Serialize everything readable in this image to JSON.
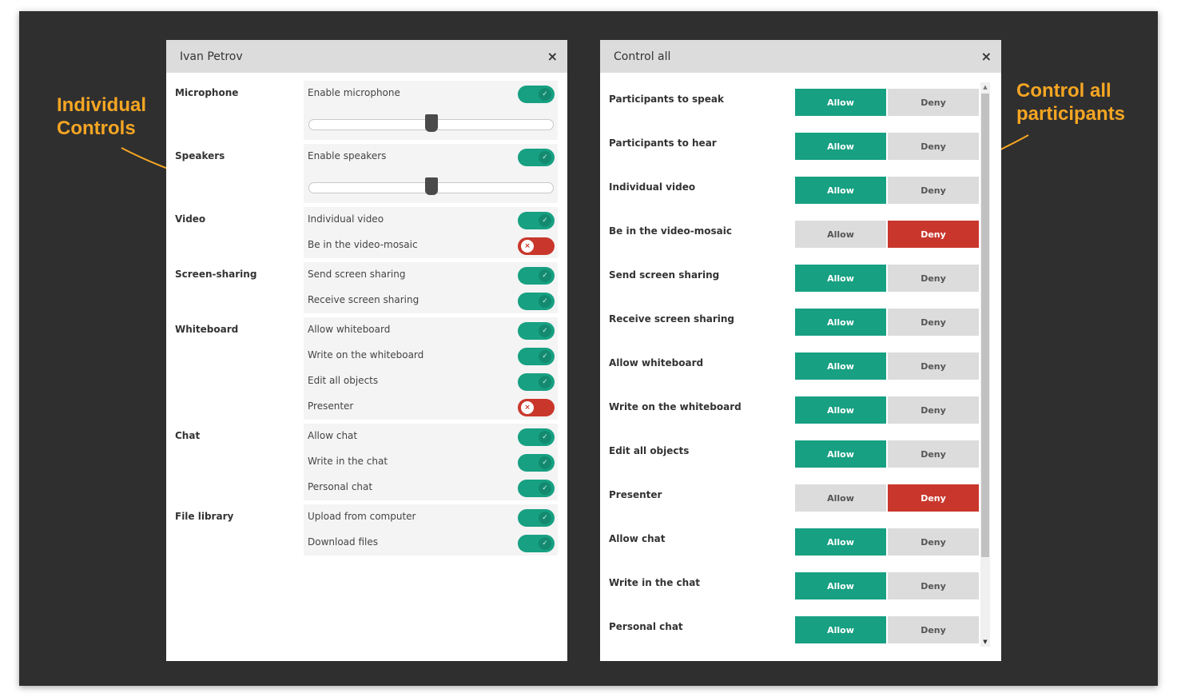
{
  "annotations": {
    "left": [
      "Individual",
      "Controls"
    ],
    "right": [
      "Control all",
      "participants"
    ]
  },
  "colors": {
    "accent": "#17a082",
    "deny": "#c9372c",
    "annotation": "#f6a623",
    "background": "#2f2f2f"
  },
  "individual": {
    "title": "Ivan Petrov",
    "close_icon": "×",
    "icons": {
      "close": "close-icon",
      "check": "check-icon",
      "cross": "x-icon"
    },
    "on_glyph": "✓",
    "off_glyph": "×",
    "sections": [
      {
        "name": "Microphone",
        "items": [
          {
            "label": "Enable microphone",
            "on": true
          }
        ],
        "volume": 0.5
      },
      {
        "name": "Speakers",
        "items": [
          {
            "label": "Enable speakers",
            "on": true
          }
        ],
        "volume": 0.5
      },
      {
        "name": "Video",
        "items": [
          {
            "label": "Individual video",
            "on": true
          },
          {
            "label": "Be in the video-mosaic",
            "on": false
          }
        ]
      },
      {
        "name": "Screen-sharing",
        "items": [
          {
            "label": "Send screen sharing",
            "on": true
          },
          {
            "label": "Receive screen sharing",
            "on": true
          }
        ]
      },
      {
        "name": "Whiteboard",
        "items": [
          {
            "label": "Allow whiteboard",
            "on": true
          },
          {
            "label": "Write on the whiteboard",
            "on": true
          },
          {
            "label": "Edit all objects",
            "on": true
          },
          {
            "label": "Presenter",
            "on": false
          }
        ]
      },
      {
        "name": "Chat",
        "items": [
          {
            "label": "Allow chat",
            "on": true
          },
          {
            "label": "Write in the chat",
            "on": true
          },
          {
            "label": "Personal chat",
            "on": true
          }
        ]
      },
      {
        "name": "File library",
        "items": [
          {
            "label": "Upload from computer",
            "on": true
          },
          {
            "label": "Download files",
            "on": true
          }
        ]
      }
    ]
  },
  "control_all": {
    "title": "Control all",
    "close_icon": "×",
    "allow_label": "Allow",
    "deny_label": "Deny",
    "scroll_up": "▲",
    "scroll_down": "▼",
    "rows": [
      {
        "label": "Participants to speak",
        "allowed": true
      },
      {
        "label": "Participants to hear",
        "allowed": true
      },
      {
        "label": "Individual video",
        "allowed": true
      },
      {
        "label": "Be in the video-mosaic",
        "allowed": false
      },
      {
        "label": "Send screen sharing",
        "allowed": true
      },
      {
        "label": "Receive screen sharing",
        "allowed": true
      },
      {
        "label": "Allow whiteboard",
        "allowed": true
      },
      {
        "label": "Write on the whiteboard",
        "allowed": true
      },
      {
        "label": "Edit all objects",
        "allowed": true
      },
      {
        "label": "Presenter",
        "allowed": false
      },
      {
        "label": "Allow chat",
        "allowed": true
      },
      {
        "label": "Write in the chat",
        "allowed": true
      },
      {
        "label": "Personal chat",
        "allowed": true
      }
    ]
  }
}
